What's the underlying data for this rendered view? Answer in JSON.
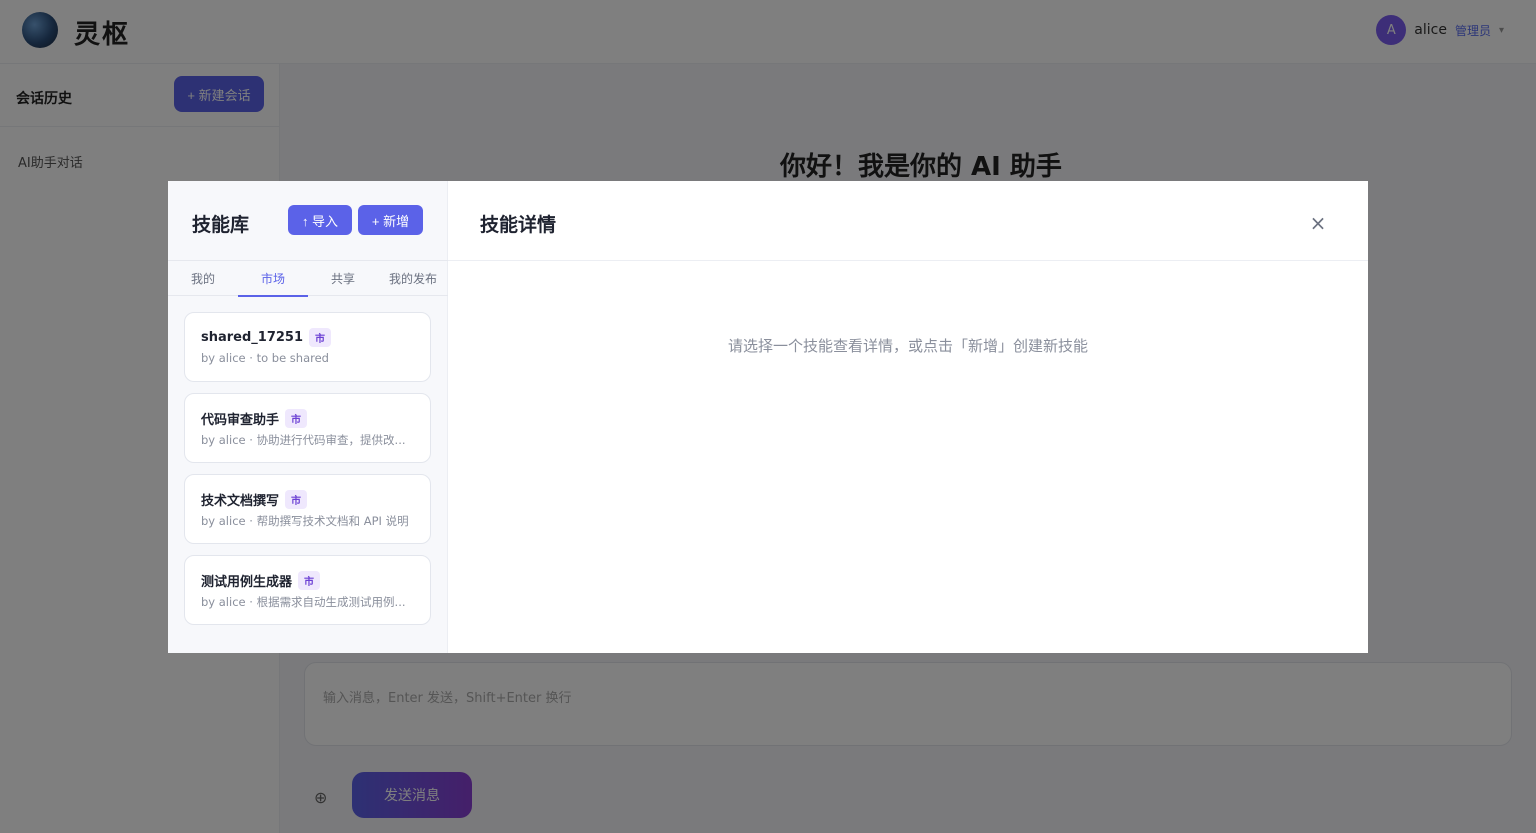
{
  "app": {
    "logo_text": "灵枢",
    "user": {
      "avatar_initial": "A",
      "name": "alice",
      "role": "管理员"
    }
  },
  "sidebar": {
    "title": "会话历史",
    "new_chat_label": "+ 新建会话",
    "items": [
      {
        "label": "AI助手对话"
      }
    ]
  },
  "main": {
    "greeting": "你好！我是你的 AI 助手",
    "input_placeholder": "输入消息，Enter 发送，Shift+Enter 换行",
    "send_label": "发送消息"
  },
  "modal": {
    "library_title": "技能库",
    "import_label": "↑ 导入",
    "add_label": "+ 新增",
    "tabs": [
      {
        "label": "我的",
        "active": false
      },
      {
        "label": "市场",
        "active": true
      },
      {
        "label": "共享",
        "active": false
      },
      {
        "label": "我的发布",
        "active": false
      }
    ],
    "skills": [
      {
        "name": "shared_17251",
        "badge": "市",
        "desc": "by alice · to be shared"
      },
      {
        "name": "代码审查助手",
        "badge": "市",
        "desc": "by alice · 协助进行代码审查，提供改..."
      },
      {
        "name": "技术文档撰写",
        "badge": "市",
        "desc": "by alice · 帮助撰写技术文档和 API 说明"
      },
      {
        "name": "测试用例生成器",
        "badge": "市",
        "desc": "by alice · 根据需求自动生成测试用例..."
      }
    ],
    "detail_title": "技能详情",
    "close_glyph": "×",
    "empty_hint": "请选择一个技能查看详情，或点击「新增」创建新技能"
  },
  "colors": {
    "accent": "#5b62e8",
    "badge_bg": "#efe8fd",
    "badge_text": "#6b3fd4",
    "overlay": "rgba(0,0,0,0.5)"
  },
  "icons": {
    "logo": "globe-logo-icon",
    "close": "close-icon",
    "attach": "attach-icon"
  }
}
